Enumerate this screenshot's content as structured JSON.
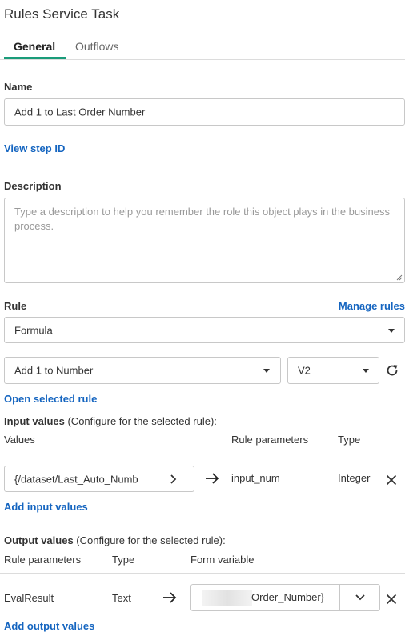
{
  "header": {
    "title": "Rules Service Task"
  },
  "tabs": [
    {
      "label": "General"
    },
    {
      "label": "Outflows"
    }
  ],
  "name": {
    "label": "Name",
    "value": "Add 1 to Last Order Number"
  },
  "view_step_id": "View step ID",
  "description": {
    "label": "Description",
    "placeholder": "Type a description to help you remember the role this object plays in the business process."
  },
  "rule": {
    "label": "Rule",
    "manage_link": "Manage rules",
    "type_value": "Formula",
    "rule_value": "Add 1 to Number",
    "version_value": "V2",
    "open_link": "Open selected rule"
  },
  "input_values": {
    "heading": "Input values",
    "heading_note": " (Configure for the selected rule):",
    "col_values": "Values",
    "col_params": "Rule parameters",
    "col_type": "Type",
    "row": {
      "value": "{/dataset/Last_Auto_Numb",
      "param": "input_num",
      "type": "Integer"
    },
    "add_link": "Add input values"
  },
  "output_values": {
    "heading": "Output values",
    "heading_note": " (Configure for the selected rule):",
    "col_params": "Rule parameters",
    "col_type": "Type",
    "col_form_var": "Form variable",
    "row": {
      "param": "EvalResult",
      "type": "Text",
      "variable": "Order_Number}"
    },
    "add_link": "Add output values"
  },
  "icons": {
    "dropdown": "chevron-down-icon",
    "refresh": "refresh-icon",
    "arrow": "arrow-right-icon",
    "remove": "close-icon",
    "expand": "chevron-right-icon"
  },
  "colors": {
    "accent": "#1a9c7a",
    "link": "#1565c0"
  }
}
